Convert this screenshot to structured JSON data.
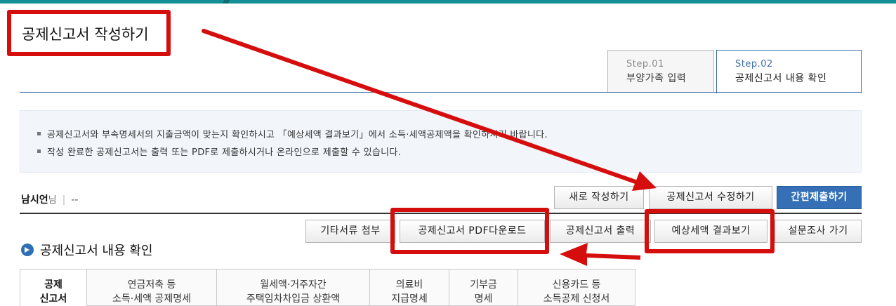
{
  "page": {
    "title": "공제신고서 작성하기"
  },
  "steps": [
    {
      "num": "Step.01",
      "label": "부양가족 입력",
      "active": false
    },
    {
      "num": "Step.02",
      "label": "공제신고서 내용 확인",
      "active": true
    }
  ],
  "notice": {
    "lines": [
      "공제신고서와 부속명세서의 지출금액이 맞는지 확인하시고 「예상세액 결과보기」에서 소득·세액공제액을 확인하시기 바랍니다.",
      "작성 완료한 공제신고서는 출력 또는 PDF로 제출하시거나 온라인으로 제출할 수 있습니다."
    ]
  },
  "user": {
    "name": "남시언",
    "suffix": "님",
    "separator": "|",
    "info": "--"
  },
  "actions_top": {
    "new_label": "새로 작성하기",
    "edit_label": "공제신고서 수정하기",
    "submit_label": "간편제출하기"
  },
  "actions_bottom": {
    "attach_label": "기타서류 첨부",
    "pdf_label": "공제신고서 PDF다운로드",
    "print_label": "공제신고서 출력",
    "result_label": "예상세액 결과보기",
    "survey_label": "설문조사 가기"
  },
  "section": {
    "title": "공제신고서 내용 확인"
  },
  "doc_tabs": [
    {
      "line1": "공제",
      "line2": "신고서"
    },
    {
      "line1": "연금저축 등",
      "line2": "소득·세액 공제명세"
    },
    {
      "line1": "월세액·거주자간",
      "line2": "주택임차차입금 상환액"
    },
    {
      "line1": "의료비",
      "line2": "지급명세"
    },
    {
      "line1": "기부금",
      "line2": "명세"
    },
    {
      "line1": "신용카드 등",
      "line2": "소득공제 신청서"
    }
  ],
  "colors": {
    "annotation": "#d50d0d",
    "accent": "#3570b6",
    "topbar": "#148f96"
  }
}
